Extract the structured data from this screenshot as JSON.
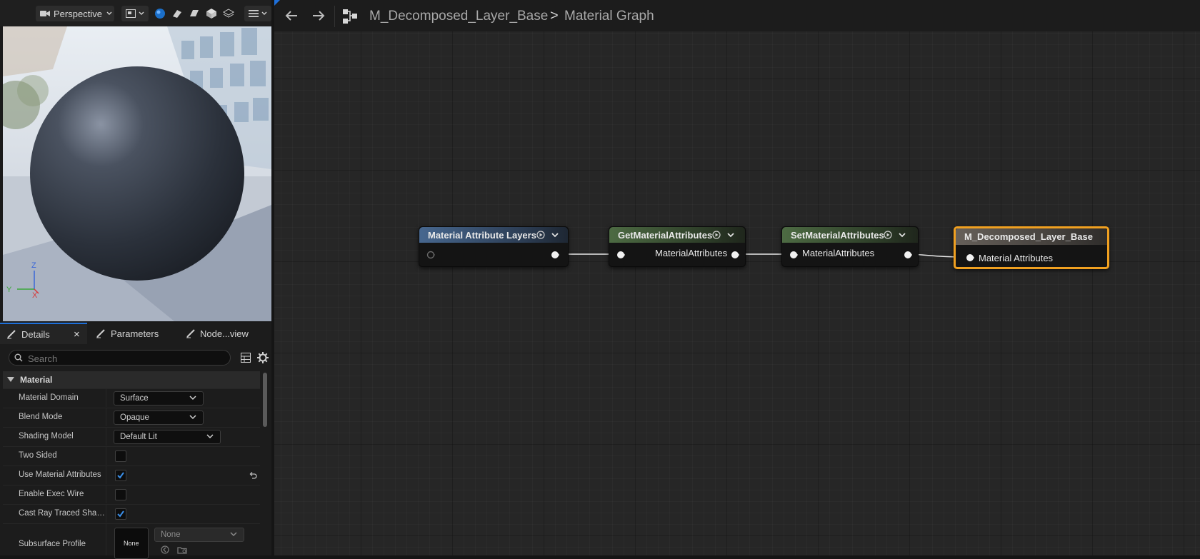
{
  "viewport": {
    "view_mode": "Perspective",
    "axes": {
      "x": "X",
      "y": "Y",
      "z": "Z"
    }
  },
  "details": {
    "tabs": [
      {
        "label": "Details"
      },
      {
        "label": "Parameters"
      },
      {
        "label": "Node...view"
      }
    ],
    "close_glyph": "×",
    "search": {
      "placeholder": "Search",
      "value": ""
    },
    "category": "Material",
    "properties": [
      {
        "label": "Material Domain",
        "type": "combo",
        "value": "Surface"
      },
      {
        "label": "Blend Mode",
        "type": "combo",
        "value": "Opaque"
      },
      {
        "label": "Shading Model",
        "type": "combo",
        "value": "Default Lit"
      },
      {
        "label": "Two Sided",
        "type": "checkbox",
        "checked": false
      },
      {
        "label": "Use Material Attributes",
        "type": "checkbox",
        "checked": true
      },
      {
        "label": "Enable Exec Wire",
        "type": "checkbox",
        "checked": false
      },
      {
        "label": "Cast Ray Traced Shad...",
        "type": "checkbox",
        "checked": true
      },
      {
        "label": "Subsurface Profile",
        "type": "asset",
        "thumb_label": "None",
        "value": "None"
      }
    ]
  },
  "graph": {
    "breadcrumb": {
      "asset": "M_Decomposed_Layer_Base",
      "separator": ">",
      "graph": "Material Graph"
    },
    "nodes": [
      {
        "title": "Material Attribute Layers",
        "header_color": "#47678f",
        "output": ""
      },
      {
        "title": "GetMaterialAttributes",
        "header_color": "#4d6b43",
        "output": "MaterialAttributes"
      },
      {
        "title": "SetMaterialAttributes",
        "header_color": "#4d6b43",
        "input": "MaterialAttributes"
      },
      {
        "title": "M_Decomposed_Layer_Base",
        "header_color": "#55504a",
        "input": "Material Attributes",
        "selected": true,
        "selection_color": "#f0a020"
      }
    ]
  },
  "colors": {
    "accent_blue": "#1e6fd9",
    "selection": "#f0a020",
    "checkbox_check": "#3a8ee8"
  },
  "icons": [
    "camera-icon",
    "chevron-down-icon",
    "viewport-icon",
    "lit-sphere-icon",
    "unlit-icon",
    "wireframe-icon",
    "cube-icon",
    "layers-icon",
    "hamburger-menu-icon",
    "back-arrow-icon",
    "forward-arrow-icon",
    "graph-icon",
    "pencil-icon",
    "search-icon",
    "table-view-icon",
    "gear-icon",
    "reset-arrow-icon"
  ]
}
